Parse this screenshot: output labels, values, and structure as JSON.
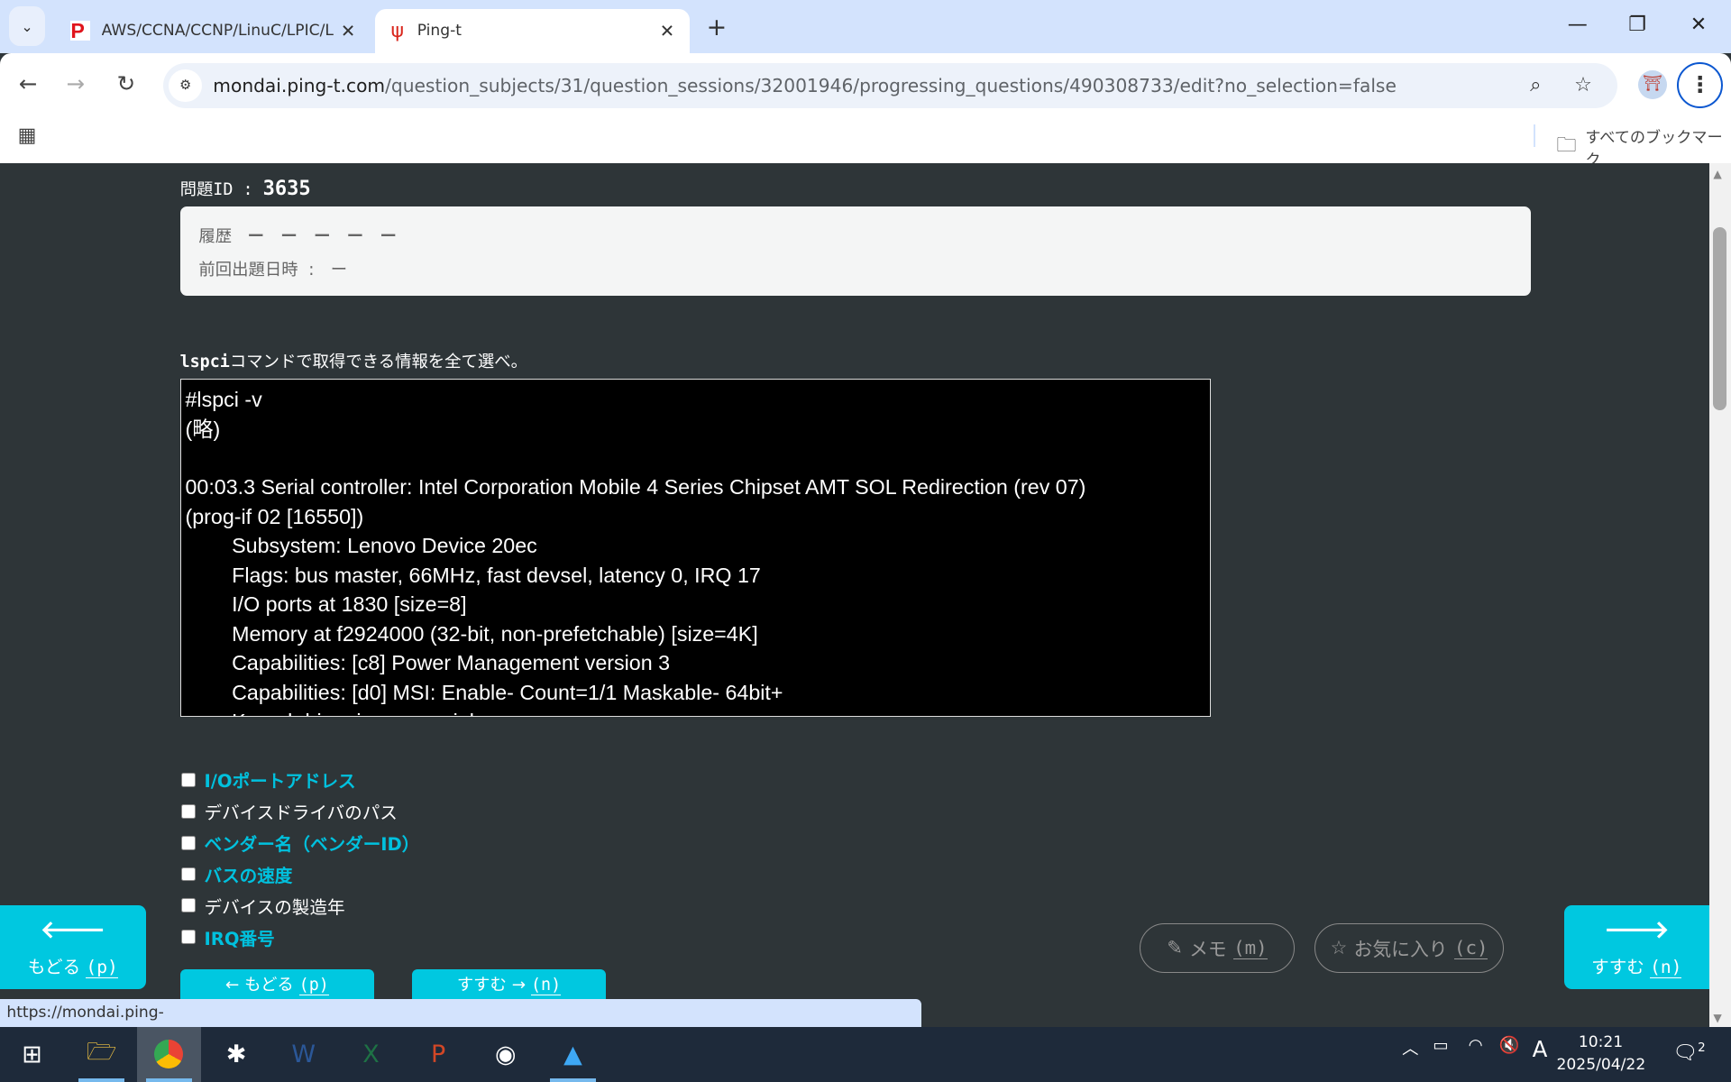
{
  "browser": {
    "tabs": [
      {
        "title": "AWS/CCNA/CCNP/LinuC/LPIC/L",
        "favicon": "P",
        "active": false
      },
      {
        "title": "Ping-t",
        "active": true
      }
    ],
    "url_host": "mondai.ping-t.com",
    "url_path": "/question_subjects/31/question_sessions/32001946/progressing_questions/490308733/edit?no_selection=false",
    "bookmarks_label": "すべてのブックマーク",
    "status_url": "https://mondai.ping-t.com/question_subjects/31/question_sessions/32001946/progressing_questions/490308733/.correct-card"
  },
  "question": {
    "id_label": "問題ID :",
    "id": "3635",
    "history_label": "履歴",
    "history_marks": "ー　ー　ー　ー　ー",
    "last_date_label": "前回出題日時",
    "last_date_value": ":　ー",
    "command": "lspci",
    "text": "コマンドで取得できる情報を全て選べ。",
    "terminal": "#lspci -v\n(略)\n\n00:03.3 Serial controller: Intel Corporation Mobile 4 Series Chipset AMT SOL Redirection (rev 07)\n(prog-if 02 [16550])\n        Subsystem: Lenovo Device 20ec\n        Flags: bus master, 66MHz, fast devsel, latency 0, IRQ 17\n        I/O ports at 1830 [size=8]\n        Memory at f2924000 (32-bit, non-prefetchable) [size=4K]\n        Capabilities: [c8] Power Management version 3\n        Capabilities: [d0] MSI: Enable- Count=1/1 Maskable- 64bit+\n        Kernel driver in use: serial",
    "options": [
      {
        "label": "I/Oポートアドレス",
        "highlight": true
      },
      {
        "label": "デバイスドライバのパス",
        "highlight": false
      },
      {
        "label": "ベンダー名（ベンダーID）",
        "highlight": true
      },
      {
        "label": "バスの速度",
        "highlight": true
      },
      {
        "label": "デバイスの製造年",
        "highlight": false
      },
      {
        "label": "IRQ番号",
        "highlight": true
      }
    ]
  },
  "nav": {
    "back": "もどる",
    "back_key": "(p)",
    "next": "すすむ",
    "next_key": "(n)",
    "memo": "メモ",
    "memo_key": "(m)",
    "fav": "お気に入り",
    "fav_key": "(c)"
  },
  "taskbar": {
    "time": "10:21",
    "date": "2025/04/22",
    "ime": "A",
    "notifications": "2"
  },
  "colors": {
    "accent": "#00c8e0",
    "page_bg": "#2e3538"
  }
}
